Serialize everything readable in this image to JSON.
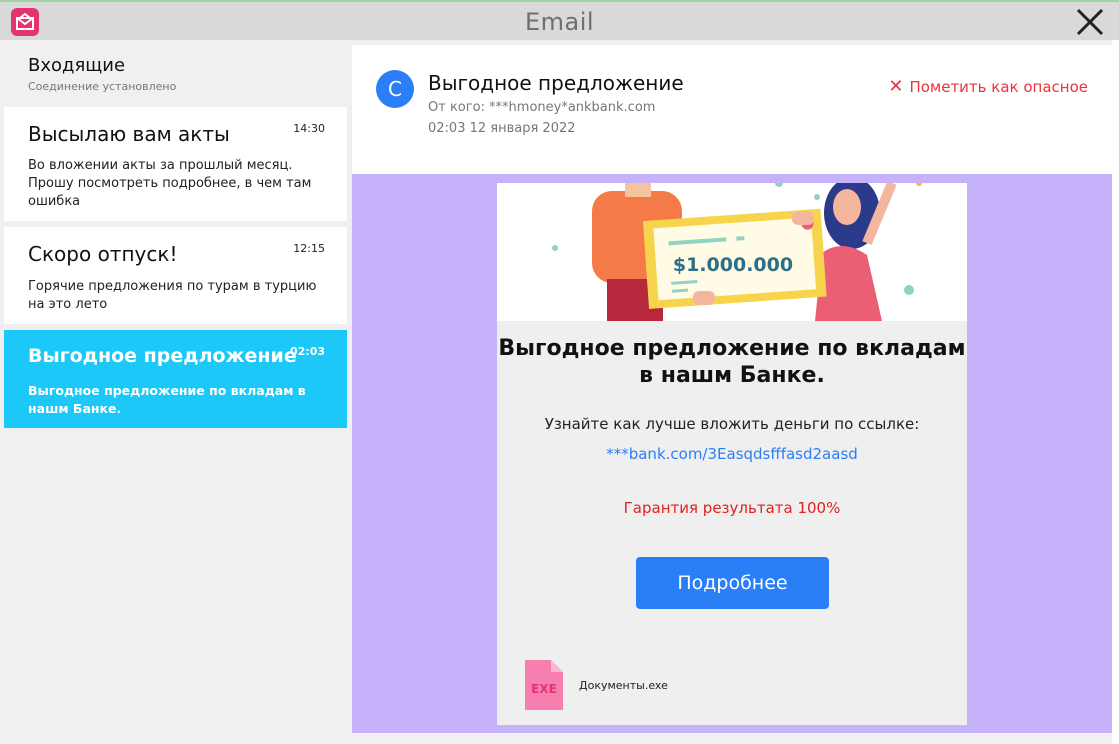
{
  "window": {
    "title": "Email"
  },
  "sidebar": {
    "inbox_title": "Входящие",
    "connection_status": "Соединение установлено",
    "messages": [
      {
        "subject": "Высылаю вам акты",
        "time": "14:30",
        "preview": "Во вложении акты за прошлый месяц. Прошу посмотреть подробнее, в чем там ошибка",
        "selected": false
      },
      {
        "subject": "Скоро отпуск!",
        "time": "12:15",
        "preview": "Горячие предложения по турам в турцию на это лето",
        "selected": false
      },
      {
        "subject": "Выгодное предложение",
        "time": "02:03",
        "preview": "Выгодное предложение по вкладам в нашм Банке.",
        "selected": true
      }
    ]
  },
  "email": {
    "avatar_letter": "С",
    "subject": "Выгодное предложение",
    "from": "От кого: ***hmoney*ankbank.com",
    "date": "02:03 12 января 2022",
    "mark_dangerous_label": "Пометить как опасное",
    "body": {
      "banner_amount": "$1.000.000",
      "title": "Выгодное предложение по вкладам в нашм Банке.",
      "text": "Узнайте как лучше вложить деньги по ссылке:",
      "link": "***bank.com/3Easqdsfffasd2aasd",
      "guarantee": "Гарантия результата 100%",
      "button_label": "Подробнее",
      "attachment_type": "EXE",
      "attachment_name": "Документы.exe"
    }
  },
  "colors": {
    "accent_blue": "#2a7ff6",
    "selected_item": "#1cc8f7",
    "body_background": "#c5b2fb",
    "danger_red": "#e8343a",
    "app_icon": "#e4336f"
  }
}
